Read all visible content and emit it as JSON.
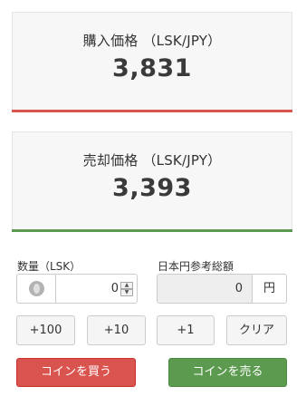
{
  "buy": {
    "label": "購入価格 （LSK/JPY）",
    "price": "3,831"
  },
  "sell": {
    "label": "売却価格 （LSK/JPY）",
    "price": "3,393"
  },
  "quantity": {
    "label": "数量（LSK）",
    "value": "0",
    "icon": "coin-icon"
  },
  "jpy_total": {
    "label": "日本円参考総額",
    "value": "0",
    "unit": "円"
  },
  "quick_buttons": {
    "plus100": "+100",
    "plus10": "+10",
    "plus1": "+1",
    "clear": "クリア"
  },
  "actions": {
    "buy_label": "コインを買う",
    "sell_label": "コインを売る"
  },
  "colors": {
    "buy": "#d9534f",
    "sell": "#5c9a4f"
  }
}
